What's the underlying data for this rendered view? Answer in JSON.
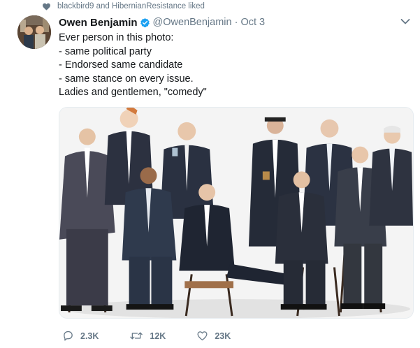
{
  "social_context": {
    "text": "blackbird9 and HibernianResistance liked"
  },
  "tweet": {
    "display_name": "Owen Benjamin",
    "handle": "@OwenBenjamin",
    "separator": "·",
    "time": "Oct 3",
    "lines": [
      "Ever person in this photo:",
      "- same political party",
      "- Endorsed same candidate",
      "- same stance on every issue.",
      "Ladies and gentlemen, \"comedy\""
    ]
  },
  "actions": {
    "replies": "2.3K",
    "retweets": "12K",
    "likes": "23K"
  },
  "colors": {
    "text_primary": "#14171a",
    "text_secondary": "#657786",
    "verified": "#1da1f2"
  },
  "icons": {
    "social_context": "heart-icon",
    "verified": "verified-badge-icon",
    "menu": "chevron-down-icon",
    "reply": "reply-icon",
    "retweet": "retweet-icon",
    "like": "heart-outline-icon"
  }
}
